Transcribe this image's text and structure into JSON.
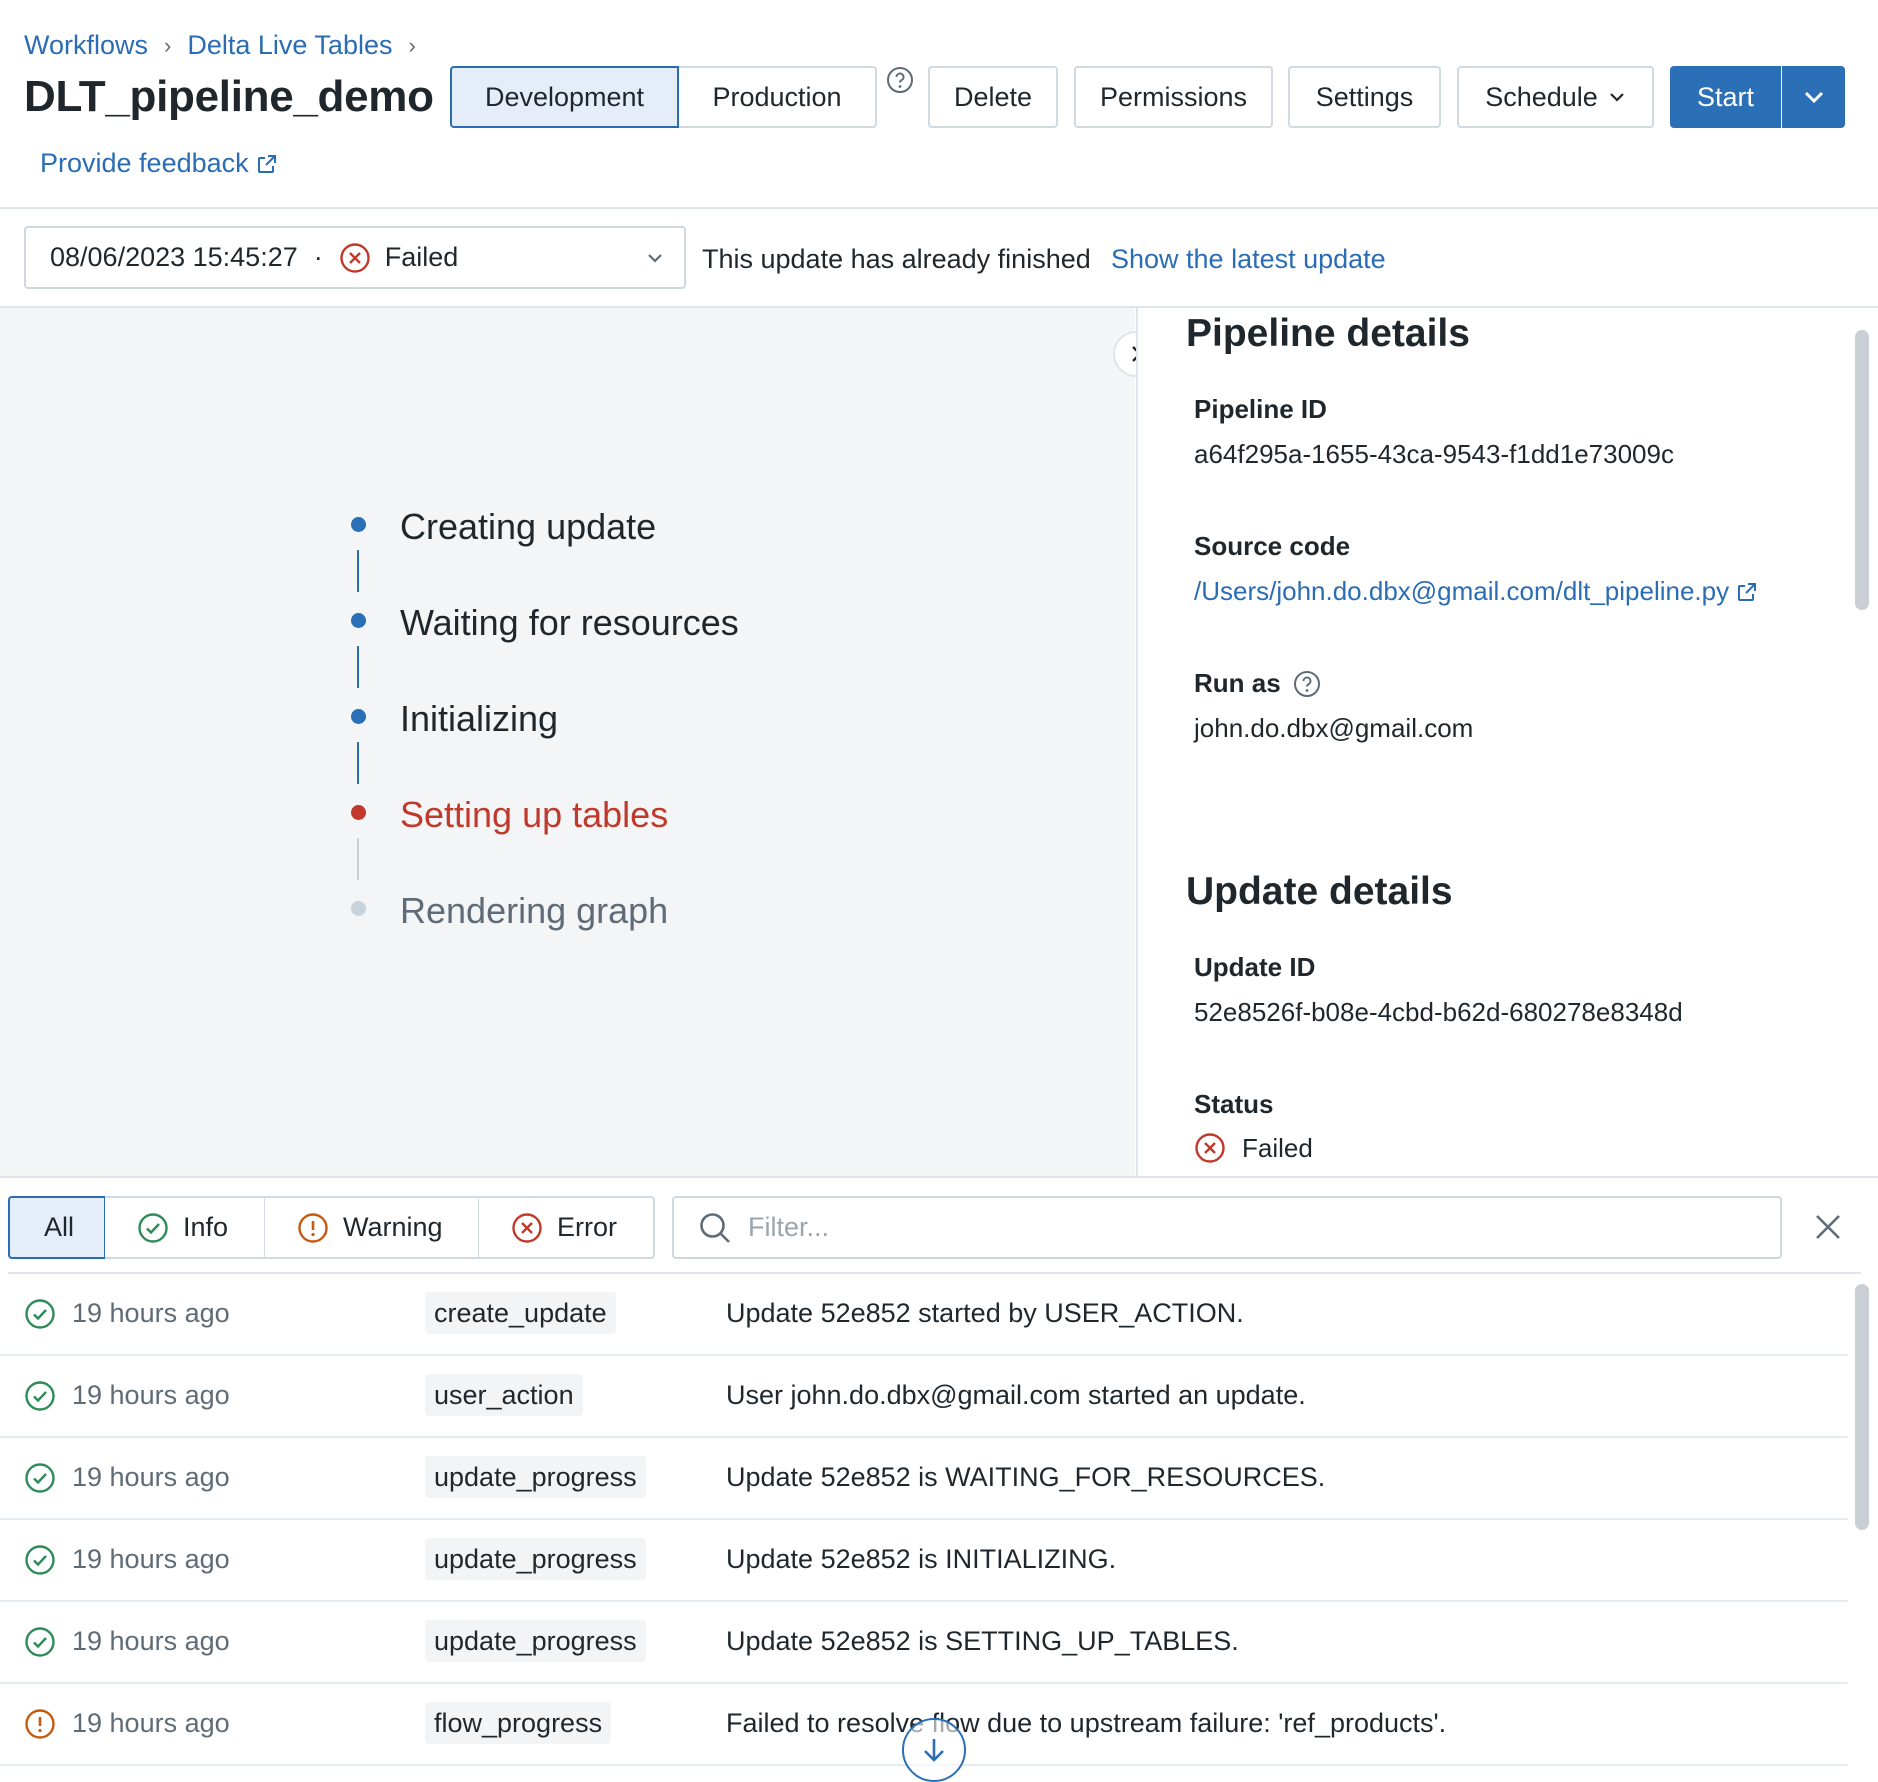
{
  "breadcrumb": {
    "items": [
      "Workflows",
      "Delta Live Tables"
    ],
    "separator": "›"
  },
  "header": {
    "title": "DLT_pipeline_demo",
    "feedback_link": "Provide feedback",
    "mode_development": "Development",
    "mode_production": "Production",
    "delete": "Delete",
    "permissions": "Permissions",
    "settings": "Settings",
    "schedule": "Schedule",
    "start": "Start"
  },
  "update_bar": {
    "timestamp": "08/06/2023 15:45:27",
    "dot": "·",
    "status": "Failed",
    "message": "This update has already finished",
    "latest_link": "Show the latest update"
  },
  "progress_steps": [
    {
      "label": "Creating update",
      "state": "done"
    },
    {
      "label": "Waiting for resources",
      "state": "done"
    },
    {
      "label": "Initializing",
      "state": "done"
    },
    {
      "label": "Setting up tables",
      "state": "failed"
    },
    {
      "label": "Rendering graph",
      "state": "pending"
    }
  ],
  "pipeline_details": {
    "heading": "Pipeline details",
    "pipeline_id_label": "Pipeline ID",
    "pipeline_id": "a64f295a-1655-43ca-9543-f1dd1e73009c",
    "source_code_label": "Source code",
    "source_code": "/Users/john.do.dbx@gmail.com/dlt_pipeline.py",
    "run_as_label": "Run as",
    "run_as": "john.do.dbx@gmail.com"
  },
  "update_details": {
    "heading": "Update details",
    "update_id_label": "Update ID",
    "update_id": "52e8526f-b08e-4cbd-b62d-680278e8348d",
    "status_label": "Status",
    "status": "Failed"
  },
  "log_filters": {
    "all": "All",
    "info": "Info",
    "warning": "Warning",
    "error": "Error",
    "filter_placeholder": "Filter..."
  },
  "events": [
    {
      "level": "info",
      "time": "19 hours ago",
      "type": "create_update",
      "message": "Update 52e852 started by USER_ACTION."
    },
    {
      "level": "info",
      "time": "19 hours ago",
      "type": "user_action",
      "message": "User john.do.dbx@gmail.com started an update."
    },
    {
      "level": "info",
      "time": "19 hours ago",
      "type": "update_progress",
      "message": "Update 52e852 is WAITING_FOR_RESOURCES."
    },
    {
      "level": "info",
      "time": "19 hours ago",
      "type": "update_progress",
      "message": "Update 52e852 is INITIALIZING."
    },
    {
      "level": "info",
      "time": "19 hours ago",
      "type": "update_progress",
      "message": "Update 52e852 is SETTING_UP_TABLES."
    },
    {
      "level": "warning",
      "time": "19 hours ago",
      "type": "flow_progress",
      "message": "Failed to resolve flow due to upstream failure: 'ref_products'."
    }
  ],
  "colors": {
    "accent": "#2b6fb6",
    "failed": "#c0392b",
    "success": "#2e8b57",
    "warning": "#c55a11"
  },
  "icons": {
    "breadcrumb_sep": "chevron-right-icon",
    "help": "question-circle-icon",
    "external": "external-link-icon",
    "collapse": "chevron-right-icon",
    "search": "search-icon",
    "close": "close-icon",
    "scroll_down": "arrow-down-circle-icon"
  }
}
